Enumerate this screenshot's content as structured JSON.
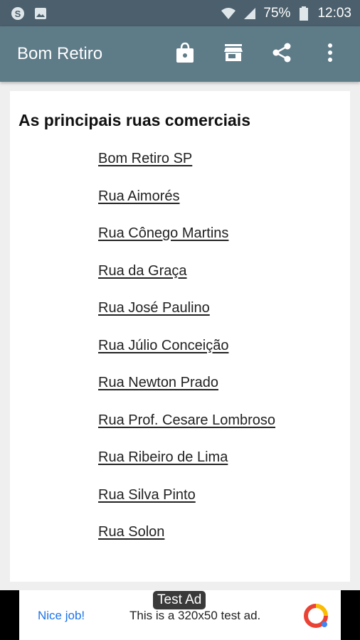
{
  "status_bar": {
    "battery": "75%",
    "time": "12:03",
    "icons": [
      "skype-icon",
      "image-icon",
      "wifi-icon",
      "signal-icon",
      "battery-icon"
    ]
  },
  "app_bar": {
    "title": "Bom Retiro",
    "actions": [
      "shopping-bag-icon",
      "store-icon",
      "share-icon",
      "more-vert-icon"
    ]
  },
  "content": {
    "heading": "As principais ruas comerciais",
    "links": [
      "Bom Retiro SP",
      "Rua Aimorés",
      "Rua Cônego Martins",
      "Rua da Graça",
      "Rua José Paulino",
      "Rua Júlio Conceição",
      "Rua Newton Prado",
      "Rua Prof. Cesare Lombroso",
      "Rua Ribeiro de Lima",
      "Rua Silva Pinto",
      "Rua Solon"
    ]
  },
  "ad": {
    "badge": "Test Ad",
    "nice": "Nice job!",
    "text": "This is a 320x50 test ad."
  },
  "colors": {
    "status_bar": "#4b5f6c",
    "app_bar": "#5e7b88",
    "link": "#222222",
    "ad_link": "#1a73e8"
  }
}
